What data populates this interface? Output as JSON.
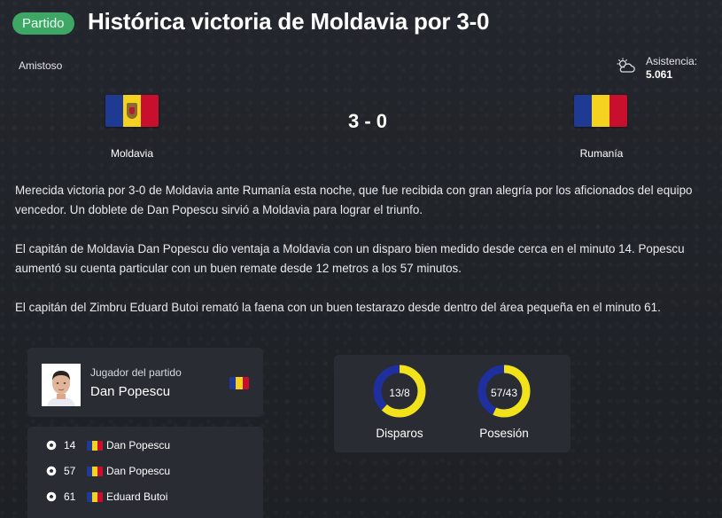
{
  "header": {
    "tag": "Partido",
    "title": "Histórica victoria de Moldavia por 3-0",
    "match_type": "Amistoso",
    "weather_icon": "partly-cloudy-icon",
    "attendance_label": "Asistencia:",
    "attendance_value": "5.061"
  },
  "match": {
    "home_team": "Moldavia",
    "away_team": "Rumanía",
    "score": "3 - 0",
    "home_flag_colors": [
      "#1f3a93",
      "#f4d21f",
      "#c8102e"
    ],
    "away_flag_colors": [
      "#1f3a93",
      "#f4d21f",
      "#c8102e"
    ]
  },
  "report": {
    "paragraphs": [
      "Merecida victoria por 3-0 de Moldavia ante Rumanía esta noche, que fue recibida con gran alegría por los aficionados del equipo vencedor. Un doblete de Dan Popescu sirvió a Moldavia para lograr el triunfo.",
      "El capitán de Moldavia Dan Popescu dio ventaja a Moldavia con un disparo bien medido desde cerca en el minuto 14. Popescu aumentó su cuenta particular con un buen remate desde 12 metros a los 57 minutos.",
      "El capitán del Zimbru Eduard Butoi remató la faena con un buen testarazo desde dentro del área pequeña en el minuto 61."
    ]
  },
  "player_of_match": {
    "label": "Jugador del partido",
    "name": "Dan Popescu"
  },
  "goals": [
    {
      "minute": "14",
      "player": "Dan Popescu"
    },
    {
      "minute": "57",
      "player": "Dan Popescu"
    },
    {
      "minute": "61",
      "player": "Eduard Butoi"
    }
  ],
  "stats": {
    "shots": {
      "label": "Disparos",
      "value_text": "13/8",
      "home": 13,
      "away": 8
    },
    "possession": {
      "label": "Posesión",
      "value_text": "57/43",
      "home": 57,
      "away": 43
    },
    "home_color": "#f2e21a",
    "away_color": "#1f2f9e"
  }
}
